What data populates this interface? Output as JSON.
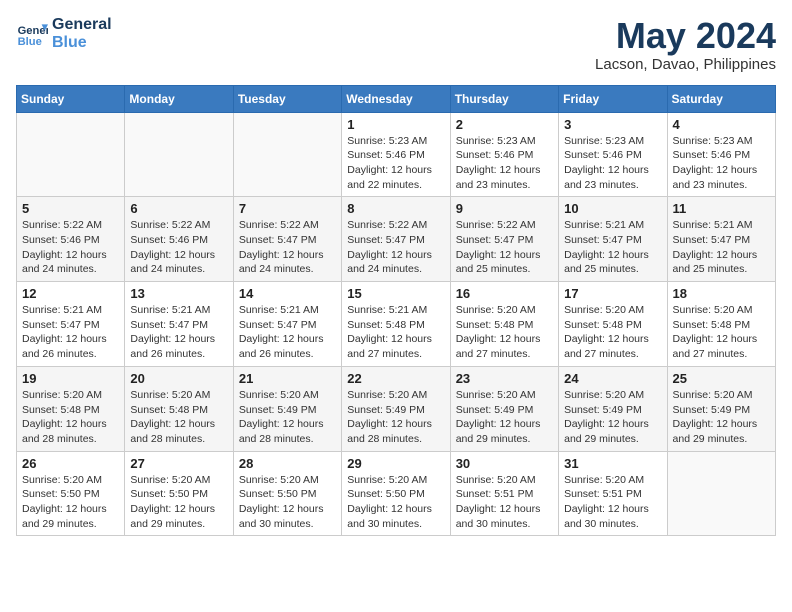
{
  "logo": {
    "line1": "General",
    "line2": "Blue"
  },
  "title": "May 2024",
  "subtitle": "Lacson, Davao, Philippines",
  "weekdays": [
    "Sunday",
    "Monday",
    "Tuesday",
    "Wednesday",
    "Thursday",
    "Friday",
    "Saturday"
  ],
  "weeks": [
    [
      {
        "day": "",
        "info": ""
      },
      {
        "day": "",
        "info": ""
      },
      {
        "day": "",
        "info": ""
      },
      {
        "day": "1",
        "info": "Sunrise: 5:23 AM\nSunset: 5:46 PM\nDaylight: 12 hours\nand 22 minutes."
      },
      {
        "day": "2",
        "info": "Sunrise: 5:23 AM\nSunset: 5:46 PM\nDaylight: 12 hours\nand 23 minutes."
      },
      {
        "day": "3",
        "info": "Sunrise: 5:23 AM\nSunset: 5:46 PM\nDaylight: 12 hours\nand 23 minutes."
      },
      {
        "day": "4",
        "info": "Sunrise: 5:23 AM\nSunset: 5:46 PM\nDaylight: 12 hours\nand 23 minutes."
      }
    ],
    [
      {
        "day": "5",
        "info": "Sunrise: 5:22 AM\nSunset: 5:46 PM\nDaylight: 12 hours\nand 24 minutes."
      },
      {
        "day": "6",
        "info": "Sunrise: 5:22 AM\nSunset: 5:46 PM\nDaylight: 12 hours\nand 24 minutes."
      },
      {
        "day": "7",
        "info": "Sunrise: 5:22 AM\nSunset: 5:47 PM\nDaylight: 12 hours\nand 24 minutes."
      },
      {
        "day": "8",
        "info": "Sunrise: 5:22 AM\nSunset: 5:47 PM\nDaylight: 12 hours\nand 24 minutes."
      },
      {
        "day": "9",
        "info": "Sunrise: 5:22 AM\nSunset: 5:47 PM\nDaylight: 12 hours\nand 25 minutes."
      },
      {
        "day": "10",
        "info": "Sunrise: 5:21 AM\nSunset: 5:47 PM\nDaylight: 12 hours\nand 25 minutes."
      },
      {
        "day": "11",
        "info": "Sunrise: 5:21 AM\nSunset: 5:47 PM\nDaylight: 12 hours\nand 25 minutes."
      }
    ],
    [
      {
        "day": "12",
        "info": "Sunrise: 5:21 AM\nSunset: 5:47 PM\nDaylight: 12 hours\nand 26 minutes."
      },
      {
        "day": "13",
        "info": "Sunrise: 5:21 AM\nSunset: 5:47 PM\nDaylight: 12 hours\nand 26 minutes."
      },
      {
        "day": "14",
        "info": "Sunrise: 5:21 AM\nSunset: 5:47 PM\nDaylight: 12 hours\nand 26 minutes."
      },
      {
        "day": "15",
        "info": "Sunrise: 5:21 AM\nSunset: 5:48 PM\nDaylight: 12 hours\nand 27 minutes."
      },
      {
        "day": "16",
        "info": "Sunrise: 5:20 AM\nSunset: 5:48 PM\nDaylight: 12 hours\nand 27 minutes."
      },
      {
        "day": "17",
        "info": "Sunrise: 5:20 AM\nSunset: 5:48 PM\nDaylight: 12 hours\nand 27 minutes."
      },
      {
        "day": "18",
        "info": "Sunrise: 5:20 AM\nSunset: 5:48 PM\nDaylight: 12 hours\nand 27 minutes."
      }
    ],
    [
      {
        "day": "19",
        "info": "Sunrise: 5:20 AM\nSunset: 5:48 PM\nDaylight: 12 hours\nand 28 minutes."
      },
      {
        "day": "20",
        "info": "Sunrise: 5:20 AM\nSunset: 5:48 PM\nDaylight: 12 hours\nand 28 minutes."
      },
      {
        "day": "21",
        "info": "Sunrise: 5:20 AM\nSunset: 5:49 PM\nDaylight: 12 hours\nand 28 minutes."
      },
      {
        "day": "22",
        "info": "Sunrise: 5:20 AM\nSunset: 5:49 PM\nDaylight: 12 hours\nand 28 minutes."
      },
      {
        "day": "23",
        "info": "Sunrise: 5:20 AM\nSunset: 5:49 PM\nDaylight: 12 hours\nand 29 minutes."
      },
      {
        "day": "24",
        "info": "Sunrise: 5:20 AM\nSunset: 5:49 PM\nDaylight: 12 hours\nand 29 minutes."
      },
      {
        "day": "25",
        "info": "Sunrise: 5:20 AM\nSunset: 5:49 PM\nDaylight: 12 hours\nand 29 minutes."
      }
    ],
    [
      {
        "day": "26",
        "info": "Sunrise: 5:20 AM\nSunset: 5:50 PM\nDaylight: 12 hours\nand 29 minutes."
      },
      {
        "day": "27",
        "info": "Sunrise: 5:20 AM\nSunset: 5:50 PM\nDaylight: 12 hours\nand 29 minutes."
      },
      {
        "day": "28",
        "info": "Sunrise: 5:20 AM\nSunset: 5:50 PM\nDaylight: 12 hours\nand 30 minutes."
      },
      {
        "day": "29",
        "info": "Sunrise: 5:20 AM\nSunset: 5:50 PM\nDaylight: 12 hours\nand 30 minutes."
      },
      {
        "day": "30",
        "info": "Sunrise: 5:20 AM\nSunset: 5:51 PM\nDaylight: 12 hours\nand 30 minutes."
      },
      {
        "day": "31",
        "info": "Sunrise: 5:20 AM\nSunset: 5:51 PM\nDaylight: 12 hours\nand 30 minutes."
      },
      {
        "day": "",
        "info": ""
      }
    ]
  ]
}
